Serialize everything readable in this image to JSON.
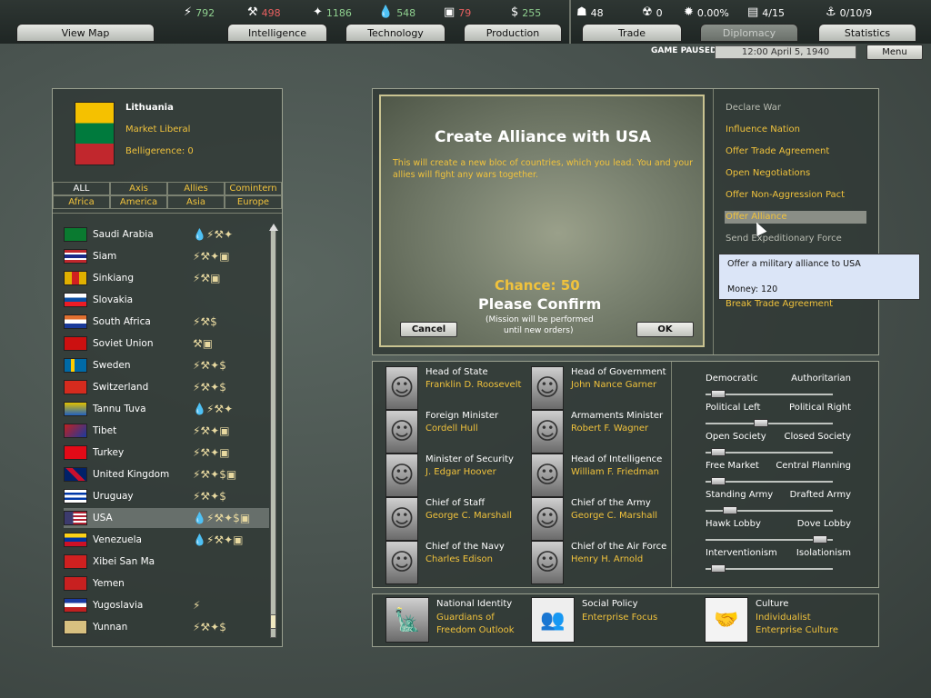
{
  "resources": [
    {
      "icon": "lightning-icon",
      "value": "792",
      "color": "#8fd08f"
    },
    {
      "icon": "metal-icon",
      "value": "498",
      "color": "#e86060"
    },
    {
      "icon": "rare-materials-icon",
      "value": "1186",
      "color": "#8fd08f"
    },
    {
      "icon": "oil-icon",
      "value": "548",
      "color": "#8fd08f"
    },
    {
      "icon": "supplies-icon",
      "value": "79",
      "color": "#e86060"
    },
    {
      "icon": "money-icon",
      "value": "255",
      "color": "#8fd08f"
    },
    {
      "icon": "manpower-icon",
      "value": "48",
      "color": "#ffffff"
    },
    {
      "icon": "nuclear-icon",
      "value": "0",
      "color": "#ffffff"
    },
    {
      "icon": "dissent-icon",
      "value": "0.00%",
      "color": "#ffffff"
    },
    {
      "icon": "transport-icon",
      "value": "4/15",
      "color": "#ffffff"
    },
    {
      "icon": "convoy-icon",
      "value": "0/10/9",
      "color": "#ffffff"
    }
  ],
  "tabs": {
    "view_map": "View Map",
    "intelligence": "Intelligence",
    "technology": "Technology",
    "production": "Production",
    "trade": "Trade",
    "diplomacy": "Diplomacy",
    "statistics": "Statistics"
  },
  "status": {
    "paused": "GAME PAUSED",
    "date": "12:00 April 5, 1940",
    "menu": "Menu"
  },
  "country": {
    "name": "Lithuania",
    "ideology": "Market Liberal",
    "belligerence": "Belligerence: 0"
  },
  "filters": {
    "row1": [
      "ALL",
      "Axis",
      "Allies",
      "Comintern"
    ],
    "row2": [
      "Africa",
      "America",
      "Asia",
      "Europe"
    ]
  },
  "countries": [
    {
      "name": "Saudi Arabia",
      "icons": "💧⚡⚒✦"
    },
    {
      "name": "Siam",
      "icons": "⚡⚒✦▣"
    },
    {
      "name": "Sinkiang",
      "icons": "⚡⚒▣"
    },
    {
      "name": "Slovakia",
      "icons": ""
    },
    {
      "name": "South Africa",
      "icons": "⚡⚒$"
    },
    {
      "name": "Soviet Union",
      "icons": "⚒▣"
    },
    {
      "name": "Sweden",
      "icons": "⚡⚒✦$"
    },
    {
      "name": "Switzerland",
      "icons": "⚡⚒✦$"
    },
    {
      "name": "Tannu Tuva",
      "icons": "💧⚡⚒✦"
    },
    {
      "name": "Tibet",
      "icons": "⚡⚒✦▣"
    },
    {
      "name": "Turkey",
      "icons": "⚡⚒✦▣"
    },
    {
      "name": "United Kingdom",
      "icons": "⚡⚒✦$▣"
    },
    {
      "name": "Uruguay",
      "icons": "⚡⚒✦$"
    },
    {
      "name": "USA",
      "icons": "💧⚡⚒✦$▣"
    },
    {
      "name": "Venezuela",
      "icons": "💧⚡⚒✦▣"
    },
    {
      "name": "Xibei San Ma",
      "icons": ""
    },
    {
      "name": "Yemen",
      "icons": ""
    },
    {
      "name": "Yugoslavia",
      "icons": "⚡"
    },
    {
      "name": "Yunnan",
      "icons": "⚡⚒✦$"
    }
  ],
  "dialog": {
    "title": "Create Alliance with USA",
    "text": "This will create a new bloc of countries, which you lead. You and your allies will fight any wars together.",
    "chance": "Chance: 50",
    "confirm": "Please Confirm",
    "note1": "(Mission will be performed",
    "note2": "until new orders)",
    "cancel": "Cancel",
    "ok": "OK"
  },
  "actions": [
    "Declare War",
    "Influence Nation",
    "Offer Trade Agreement",
    "Open Negotiations",
    "Offer Non-Aggression Pact",
    "Offer Alliance",
    "Send Expeditionary Force",
    "Break Trade Agreement"
  ],
  "tooltip": {
    "line1": "Offer a military alliance to USA",
    "line2": "Money: 120"
  },
  "ministers": [
    {
      "title": "Head of State",
      "name": "Franklin D. Roosevelt"
    },
    {
      "title": "Head of Government",
      "name": "John Nance Garner"
    },
    {
      "title": "Foreign Minister",
      "name": "Cordell Hull"
    },
    {
      "title": "Armaments Minister",
      "name": "Robert F. Wagner"
    },
    {
      "title": "Minister of Security",
      "name": "J. Edgar Hoover"
    },
    {
      "title": "Head of Intelligence",
      "name": "William F. Friedman"
    },
    {
      "title": "Chief of Staff",
      "name": "George C. Marshall"
    },
    {
      "title": "Chief of the Army",
      "name": "George C. Marshall"
    },
    {
      "title": "Chief of the Navy",
      "name": "Charles Edison"
    },
    {
      "title": "Chief of the Air Force",
      "name": "Henry H. Arnold"
    }
  ],
  "policies": [
    {
      "left": "Democratic",
      "right": "Authoritarian",
      "value": 0.05
    },
    {
      "left": "Political Left",
      "right": "Political Right",
      "value": 0.43
    },
    {
      "left": "Open Society",
      "right": "Closed Society",
      "value": 0.05
    },
    {
      "left": "Free Market",
      "right": "Central Planning",
      "value": 0.05
    },
    {
      "left": "Standing Army",
      "right": "Drafted Army",
      "value": 0.15
    },
    {
      "left": "Hawk Lobby",
      "right": "Dove Lobby",
      "value": 0.95
    },
    {
      "left": "Interventionism",
      "right": "Isolationism",
      "value": 0.05
    }
  ],
  "identity": [
    {
      "title": "National Identity",
      "line1": "Guardians of",
      "line2": "Freedom Outlook"
    },
    {
      "title": "Social Policy",
      "line1": "Enterprise Focus",
      "line2": ""
    },
    {
      "title": "Culture",
      "line1": "Individualist",
      "line2": "Enterprise Culture"
    }
  ]
}
